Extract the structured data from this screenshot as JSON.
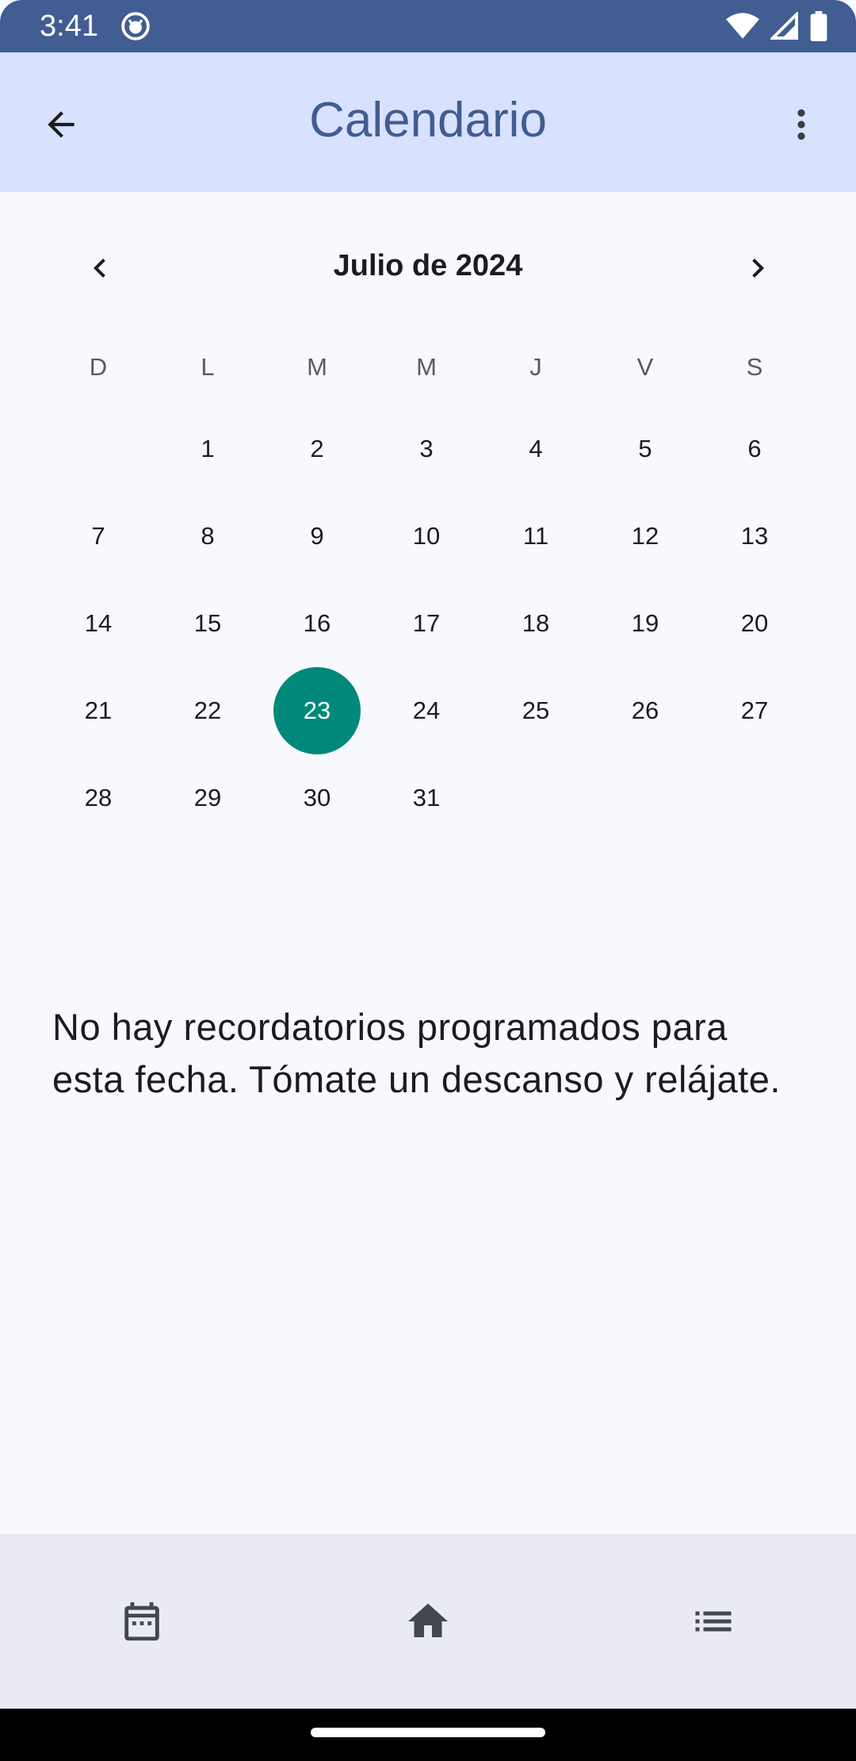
{
  "status_bar": {
    "time": "3:41",
    "icons": [
      "app-notification-icon",
      "wifi-icon",
      "cell-signal-icon",
      "battery-icon"
    ]
  },
  "app_bar": {
    "title": "Calendario",
    "back_icon": "arrow-back-icon",
    "menu_icon": "more-vert-icon"
  },
  "calendar": {
    "month_label": "Julio de 2024",
    "prev_icon": "chevron-left-icon",
    "next_icon": "chevron-right-icon",
    "weekdays": [
      "D",
      "L",
      "M",
      "M",
      "J",
      "V",
      "S"
    ],
    "start_offset": 1,
    "days_in_month": 31,
    "days": [
      "1",
      "2",
      "3",
      "4",
      "5",
      "6",
      "7",
      "8",
      "9",
      "10",
      "11",
      "12",
      "13",
      "14",
      "15",
      "16",
      "17",
      "18",
      "19",
      "20",
      "21",
      "22",
      "23",
      "24",
      "25",
      "26",
      "27",
      "28",
      "29",
      "30",
      "31"
    ],
    "selected_day": "23",
    "selected_color": "#00897b"
  },
  "empty_message": "No hay recordatorios programados para esta fecha. Tómate un descanso y relájate.",
  "bottom_nav": {
    "items": [
      {
        "icon": "calendar-icon"
      },
      {
        "icon": "home-icon"
      },
      {
        "icon": "list-icon"
      }
    ]
  },
  "colors": {
    "status_bar": "#415d92",
    "app_bar": "#d8e2ff",
    "title": "#415d92",
    "background": "#f8f8ff",
    "bottom_nav": "#eaeaf4"
  }
}
